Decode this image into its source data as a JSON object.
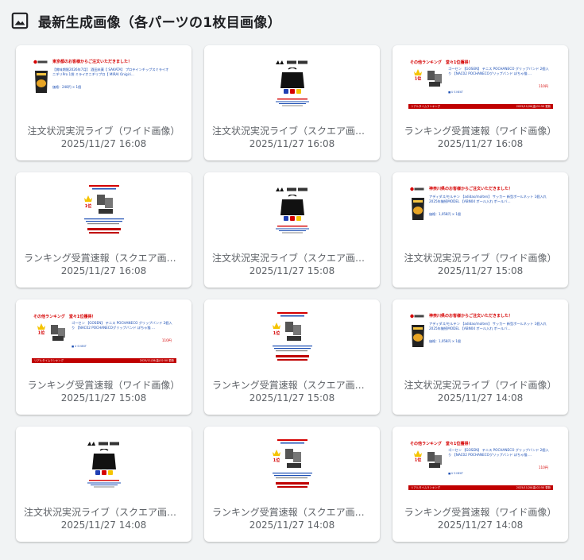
{
  "header": {
    "title": "最新生成画像（各パーツの1枚目画像）",
    "icon": "image-icon"
  },
  "colors": {
    "accent_red": "#d50000",
    "link_blue": "#1a4db3",
    "bar_red": "#c00000"
  },
  "cards": [
    {
      "kind": "order_wide",
      "title": "注文状況実況ライブ（ワイド画像）",
      "date": "2025/11/27 16:08",
      "thumb": {
        "heading": "東京都のお客様からご注文いただきました！",
        "description": "【賞味期限2026年7月】 酒田米菓【 SAKATA】 プロテインチップスミライオニギリPro 1袋 ミライオニギリプロ【 MIRAI Onigiri…",
        "price": "価格：248円 × 1個"
      }
    },
    {
      "kind": "order_square",
      "title": "注文状況実況ライブ（スクエア画像）",
      "date": "2025/11/27 16:08",
      "thumb": {}
    },
    {
      "kind": "ranking_wide",
      "title": "ランキング受賞速報（ワイド画像）",
      "date": "2025/11/27 16:08",
      "thumb": {
        "heading": "その他ランキング　堂々1位獲得！",
        "rank": "1位",
        "description": "ゴーセン 【GOSEN】 テニス POCHANECO グリップバンド 2個入り 【NAC02 POCHANECOグリップバンド ぽちゃ猫 …",
        "price": "110円",
        "sub": "■ U S NEXT",
        "bar_left": "リアルタイムランキング",
        "bar_right": "2025/11/28(金)02:50 更新"
      }
    },
    {
      "kind": "ranking_square",
      "title": "ランキング受賞速報（スクエア画像）",
      "date": "2025/11/27 16:08",
      "thumb": {
        "rank": "1位"
      }
    },
    {
      "kind": "order_square",
      "title": "注文状況実況ライブ（スクエア画像）",
      "date": "2025/11/27 15:08",
      "thumb": {}
    },
    {
      "kind": "order_wide",
      "title": "注文状況実況ライブ（ワイド画像）",
      "date": "2025/11/27 15:08",
      "thumb": {
        "heading": "神奈川県のお客様からご注文いただきました！",
        "description": "アディダス/モルテン 【adidas/molten】 サッカー 新型ボールネット 1個入れ 2025年継続MODEL 【ABN04 ボール入れ ボールバ…",
        "price": "価格：1,058円 × 1個"
      }
    },
    {
      "kind": "ranking_wide",
      "title": "ランキング受賞速報（ワイド画像）",
      "date": "2025/11/27 15:08",
      "thumb": {
        "heading": "その他ランキング　堂々1位獲得！",
        "rank": "1位",
        "description": "ゴーセン 【GOSEN】 テニス POCHANECO グリップバンド 2個入り 【NAC02 POCHANECOグリップバンド ぽちゃ猫 …",
        "price": "110円",
        "sub": "■ U S NEXT",
        "bar_left": "リアルタイムランキング",
        "bar_right": "2025/11/28(金)02:50 更新"
      }
    },
    {
      "kind": "ranking_square",
      "title": "ランキング受賞速報（スクエア画像）",
      "date": "2025/11/27 15:08",
      "thumb": {
        "rank": "1位"
      }
    },
    {
      "kind": "order_wide",
      "title": "注文状況実況ライブ（ワイド画像）",
      "date": "2025/11/27 14:08",
      "thumb": {
        "heading": "神奈川県のお客様からご注文いただきました！",
        "description": "アディダス/モルテン 【adidas/molten】 サッカー 新型ボールネット 1個入れ 2025年継続MODEL 【ABN04 ボール入れ ボールバ…",
        "price": "価格：1,058円 × 1個"
      }
    },
    {
      "kind": "order_square",
      "title": "注文状況実況ライブ（スクエア画像）",
      "date": "2025/11/27 14:08",
      "thumb": {}
    },
    {
      "kind": "ranking_square",
      "title": "ランキング受賞速報（スクエア画像）",
      "date": "2025/11/27 14:08",
      "thumb": {
        "rank": "1位"
      }
    },
    {
      "kind": "ranking_wide",
      "title": "ランキング受賞速報（ワイド画像）",
      "date": "2025/11/27 14:08",
      "thumb": {
        "heading": "その他ランキング　堂々1位獲得！",
        "rank": "1位",
        "description": "ゴーセン 【GOSEN】 テニス POCHANECO グリップバンド 2個入り 【NAC02 POCHANECOグリップバンド ぽちゃ猫 …",
        "price": "110円",
        "sub": "■ U S NEXT",
        "bar_left": "リアルタイムランキング",
        "bar_right": "2025/11/28(金)02:50 更新"
      }
    }
  ]
}
